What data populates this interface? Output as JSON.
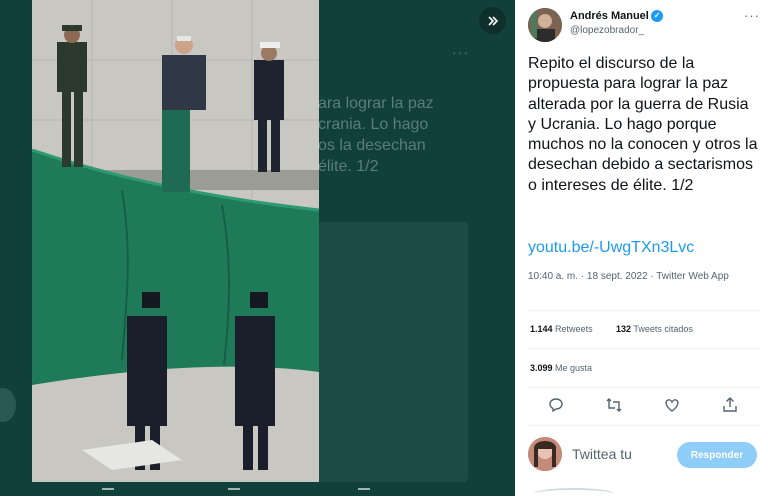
{
  "media": {
    "background_text": "ara lograr la paz\ncrania. Lo hago\nos la desechan\nélite. 1/2",
    "photo_alt_icon": "ceremony-photo"
  },
  "tweet": {
    "author": "Andrés Manuel",
    "handle": "@lopezobrador_",
    "text": "Repito el discurso de la propuesta para lograr la paz alterada por la guerra de Rusia y Ucrania. Lo hago porque muchos no la conocen y otros la desechan debido a sectarismos o intereses de élite. 1/2",
    "link": "youtu.be/-UwgTXn3Lvc",
    "timestamp": "10:40 a. m. · 18 sept. 2022 · Twitter Web App",
    "retweets_count": "1.144",
    "retweets_label": "Retweets",
    "quotes_count": "132",
    "quotes_label": "Tweets citados",
    "likes_count": "3.099",
    "likes_label": "Me gusta"
  },
  "reply": {
    "placeholder": "Twittea tu",
    "button_label": "Responder"
  },
  "colors": {
    "accent": "#1d9bf0",
    "media_bg": "#11403a",
    "flag_green": "#1f7a5a"
  }
}
